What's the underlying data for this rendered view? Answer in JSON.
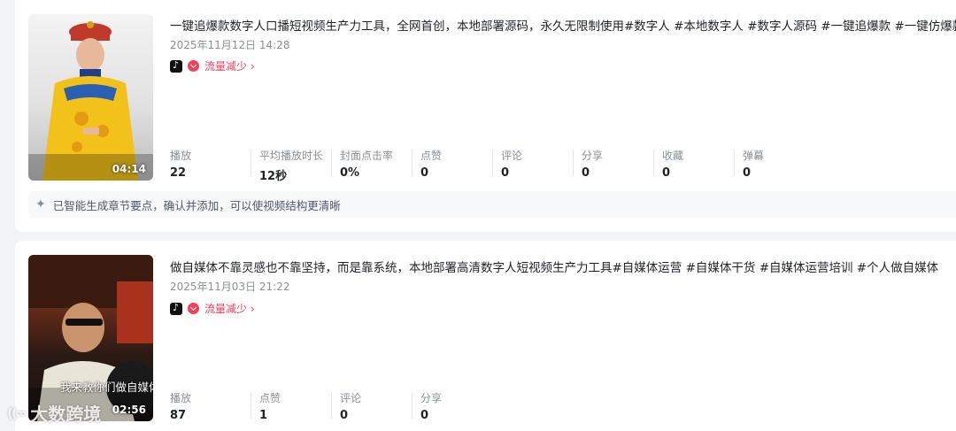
{
  "videos": [
    {
      "title": "一键追爆款数字人口播短视频生产力工具，全网首创，本地部署源码，永久无限制使用#数字人 #本地数字人 #数字人源码 #一键追爆款 #一键仿爆款",
      "date": "2025年11月12日 14:28",
      "duration": "04:14",
      "platform_icon": "douyin-icon",
      "flow_label": "流量减少",
      "stats": [
        {
          "label": "播放",
          "value": "22"
        },
        {
          "label": "平均播放时长",
          "value": "12秒"
        },
        {
          "label": "封面点击率",
          "value": "0%"
        },
        {
          "label": "点赞",
          "value": "0"
        },
        {
          "label": "评论",
          "value": "0"
        },
        {
          "label": "分享",
          "value": "0"
        },
        {
          "label": "收藏",
          "value": "0"
        },
        {
          "label": "弹幕",
          "value": "0"
        }
      ],
      "chapter_hint": "已智能生成章节要点，确认并添加，可以使视频结构更清晰"
    },
    {
      "title": "做自媒体不靠灵感也不靠坚持，而是靠系统，本地部署高清数字人短视频生产力工具#自媒体运营 #自媒体干货 #自媒体运营培训 #个人做自媒体",
      "date": "2025年11月03日 21:22",
      "duration": "02:56",
      "thumb_caption": "我来教你们做自媒体",
      "platform_icon": "douyin-icon",
      "flow_label": "流量减少",
      "stats": [
        {
          "label": "播放",
          "value": "87"
        },
        {
          "label": "点赞",
          "value": "1"
        },
        {
          "label": "评论",
          "value": "0"
        },
        {
          "label": "分享",
          "value": "0"
        }
      ]
    }
  ],
  "watermark": {
    "logo": "((∞",
    "text": "大数跨境"
  },
  "colors": {
    "accent": "#f0405a",
    "muted": "#8a8f99",
    "background": "#f2f3f5"
  }
}
